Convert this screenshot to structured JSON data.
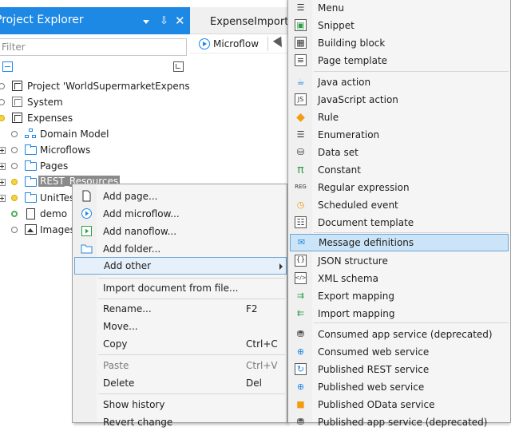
{
  "explorer": {
    "title": "Project Explorer",
    "filter_placeholder": "Filter",
    "tree": [
      {
        "label": "Project 'WorldSupermarketExpenses_M"
      },
      {
        "label": "System"
      },
      {
        "label": "Expenses"
      },
      {
        "label": "Domain Model"
      },
      {
        "label": "Microflows"
      },
      {
        "label": "Pages"
      },
      {
        "label": "REST_Resources"
      },
      {
        "label": "UnitTest"
      },
      {
        "label": "demo"
      },
      {
        "label": "Images"
      }
    ]
  },
  "editor": {
    "tab_label": "ExpenseImport [l",
    "toolbar_label": "Microflow"
  },
  "context_menu": {
    "items": [
      {
        "label": "Add page..."
      },
      {
        "label": "Add microflow..."
      },
      {
        "label": "Add nanoflow..."
      },
      {
        "label": "Add folder..."
      },
      {
        "label": "Add other"
      },
      {
        "label": "Import document from file..."
      },
      {
        "label": "Rename...",
        "shortcut": "F2"
      },
      {
        "label": "Move..."
      },
      {
        "label": "Copy",
        "shortcut": "Ctrl+C"
      },
      {
        "label": "Paste",
        "shortcut": "Ctrl+V"
      },
      {
        "label": "Delete",
        "shortcut": "Del"
      },
      {
        "label": "Show history"
      },
      {
        "label": "Revert change"
      }
    ]
  },
  "submenu": {
    "items": [
      {
        "label": "Menu",
        "icon": "menu-icon"
      },
      {
        "label": "Snippet",
        "icon": "snippet-icon"
      },
      {
        "label": "Building block",
        "icon": "building-block-icon"
      },
      {
        "label": "Page template",
        "icon": "page-template-icon"
      },
      {
        "label": "Java action",
        "icon": "java-cup-icon"
      },
      {
        "label": "JavaScript action",
        "icon": "js-icon"
      },
      {
        "label": "Rule",
        "icon": "rule-diamond-icon"
      },
      {
        "label": "Enumeration",
        "icon": "enumeration-list-icon"
      },
      {
        "label": "Data set",
        "icon": "dataset-icon"
      },
      {
        "label": "Constant",
        "icon": "pi-icon"
      },
      {
        "label": "Regular expression",
        "icon": "regex-icon"
      },
      {
        "label": "Scheduled event",
        "icon": "scheduled-event-icon"
      },
      {
        "label": "Document template",
        "icon": "document-template-icon"
      },
      {
        "label": "Message definitions",
        "icon": "message-definitions-icon"
      },
      {
        "label": "JSON structure",
        "icon": "json-icon"
      },
      {
        "label": "XML schema",
        "icon": "xml-icon"
      },
      {
        "label": "Export mapping",
        "icon": "export-mapping-icon"
      },
      {
        "label": "Import mapping",
        "icon": "import-mapping-icon"
      },
      {
        "label": "Consumed app service (deprecated)",
        "icon": "consumed-app-service-icon"
      },
      {
        "label": "Consumed web service",
        "icon": "globe-icon"
      },
      {
        "label": "Published REST service",
        "icon": "published-rest-icon"
      },
      {
        "label": "Published web service",
        "icon": "globe-icon"
      },
      {
        "label": "Published OData service",
        "icon": "odata-icon"
      },
      {
        "label": "Published app service (deprecated)",
        "icon": "published-app-service-icon"
      }
    ]
  },
  "colors": {
    "accent": "#1e88e5",
    "hover": "#cce4f7"
  }
}
